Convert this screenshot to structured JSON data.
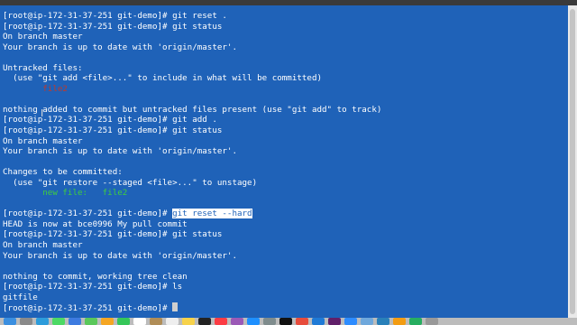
{
  "terminal": {
    "lines": [
      {
        "segments": [
          {
            "text": "[root@ip-172-31-37-251 git-demo]# git reset ."
          }
        ]
      },
      {
        "segments": [
          {
            "text": "[root@ip-172-31-37-251 git-demo]# git status"
          }
        ]
      },
      {
        "segments": [
          {
            "text": "On branch master"
          }
        ]
      },
      {
        "segments": [
          {
            "text": "Your branch is up to date with 'origin/master'."
          }
        ]
      },
      {
        "segments": [
          {
            "text": ""
          }
        ]
      },
      {
        "segments": [
          {
            "text": "Untracked files:"
          }
        ]
      },
      {
        "segments": [
          {
            "text": "  (use \"git add <file>...\" to include in what will be committed)"
          }
        ]
      },
      {
        "segments": [
          {
            "text": "        "
          },
          {
            "text": "file2",
            "style": "red"
          }
        ]
      },
      {
        "segments": [
          {
            "text": ""
          }
        ]
      },
      {
        "segments": [
          {
            "text": "nothing added to commit but untracked files present (use \"git add\" to track)"
          }
        ]
      },
      {
        "segments": [
          {
            "text": "[root@ip-172-31-37-251 git-demo]# git add ."
          }
        ]
      },
      {
        "segments": [
          {
            "text": "[root@ip-172-31-37-251 git-demo]# git status"
          }
        ]
      },
      {
        "segments": [
          {
            "text": "On branch master"
          }
        ]
      },
      {
        "segments": [
          {
            "text": "Your branch is up to date with 'origin/master'."
          }
        ]
      },
      {
        "segments": [
          {
            "text": ""
          }
        ]
      },
      {
        "segments": [
          {
            "text": "Changes to be committed:"
          }
        ]
      },
      {
        "segments": [
          {
            "text": "  (use \"git restore --staged <file>...\" to unstage)"
          }
        ]
      },
      {
        "segments": [
          {
            "text": "        "
          },
          {
            "text": "new file:   file2",
            "style": "green"
          }
        ]
      },
      {
        "segments": [
          {
            "text": ""
          }
        ]
      },
      {
        "segments": [
          {
            "text": "[root@ip-172-31-37-251 git-demo]# "
          },
          {
            "text": "git reset --hard",
            "style": "sel"
          }
        ]
      },
      {
        "segments": [
          {
            "text": "HEAD is now at bce0996 My pull commit"
          }
        ]
      },
      {
        "segments": [
          {
            "text": "[root@ip-172-31-37-251 git-demo]# git status"
          }
        ]
      },
      {
        "segments": [
          {
            "text": "On branch master"
          }
        ]
      },
      {
        "segments": [
          {
            "text": "Your branch is up to date with 'origin/master'."
          }
        ]
      },
      {
        "segments": [
          {
            "text": ""
          }
        ]
      },
      {
        "segments": [
          {
            "text": "nothing to commit, working tree clean"
          }
        ]
      },
      {
        "segments": [
          {
            "text": "[root@ip-172-31-37-251 git-demo]# ls"
          }
        ]
      },
      {
        "segments": [
          {
            "text": "gitfile"
          }
        ]
      },
      {
        "segments": [
          {
            "text": "[root@ip-172-31-37-251 git-demo]# "
          }
        ],
        "cursor": true
      }
    ],
    "colors": {
      "background": "#1f62b8",
      "text": "#ffffff",
      "untracked": "#c0392b",
      "staged": "#3fcf3f"
    }
  },
  "dock": {
    "icons": [
      {
        "name": "finder-icon",
        "color": "#3b8fe0"
      },
      {
        "name": "launchpad-icon",
        "color": "#8a8a8a"
      },
      {
        "name": "safari-icon",
        "color": "#2d9cdb"
      },
      {
        "name": "messages-icon",
        "color": "#4cd964"
      },
      {
        "name": "mail-icon",
        "color": "#3d7be0"
      },
      {
        "name": "maps-icon",
        "color": "#5ac85a"
      },
      {
        "name": "photos-icon",
        "color": "#f5a623"
      },
      {
        "name": "facetime-icon",
        "color": "#35c759"
      },
      {
        "name": "calendar-icon",
        "color": "#ffffff"
      },
      {
        "name": "contacts-icon",
        "color": "#b08d57"
      },
      {
        "name": "reminders-icon",
        "color": "#eeeeee"
      },
      {
        "name": "notes-icon",
        "color": "#f7d24a"
      },
      {
        "name": "tv-icon",
        "color": "#222222"
      },
      {
        "name": "music-icon",
        "color": "#fc3c44"
      },
      {
        "name": "podcasts-icon",
        "color": "#9b59b6"
      },
      {
        "name": "app-store-icon",
        "color": "#1e90ff"
      },
      {
        "name": "settings-icon",
        "color": "#7f8c8d"
      },
      {
        "name": "terminal-icon",
        "color": "#111111"
      },
      {
        "name": "chrome-icon",
        "color": "#e74c3c"
      },
      {
        "name": "vscode-icon",
        "color": "#1f7ad6"
      },
      {
        "name": "slack-icon",
        "color": "#611f69"
      },
      {
        "name": "zoom-icon",
        "color": "#2d8cff"
      },
      {
        "name": "preview-icon",
        "color": "#6fa8dc"
      },
      {
        "name": "keynote-icon",
        "color": "#2980b9"
      },
      {
        "name": "pages-icon",
        "color": "#f39c12"
      },
      {
        "name": "numbers-icon",
        "color": "#27ae60"
      },
      {
        "name": "trash-icon",
        "color": "#999999"
      }
    ]
  }
}
